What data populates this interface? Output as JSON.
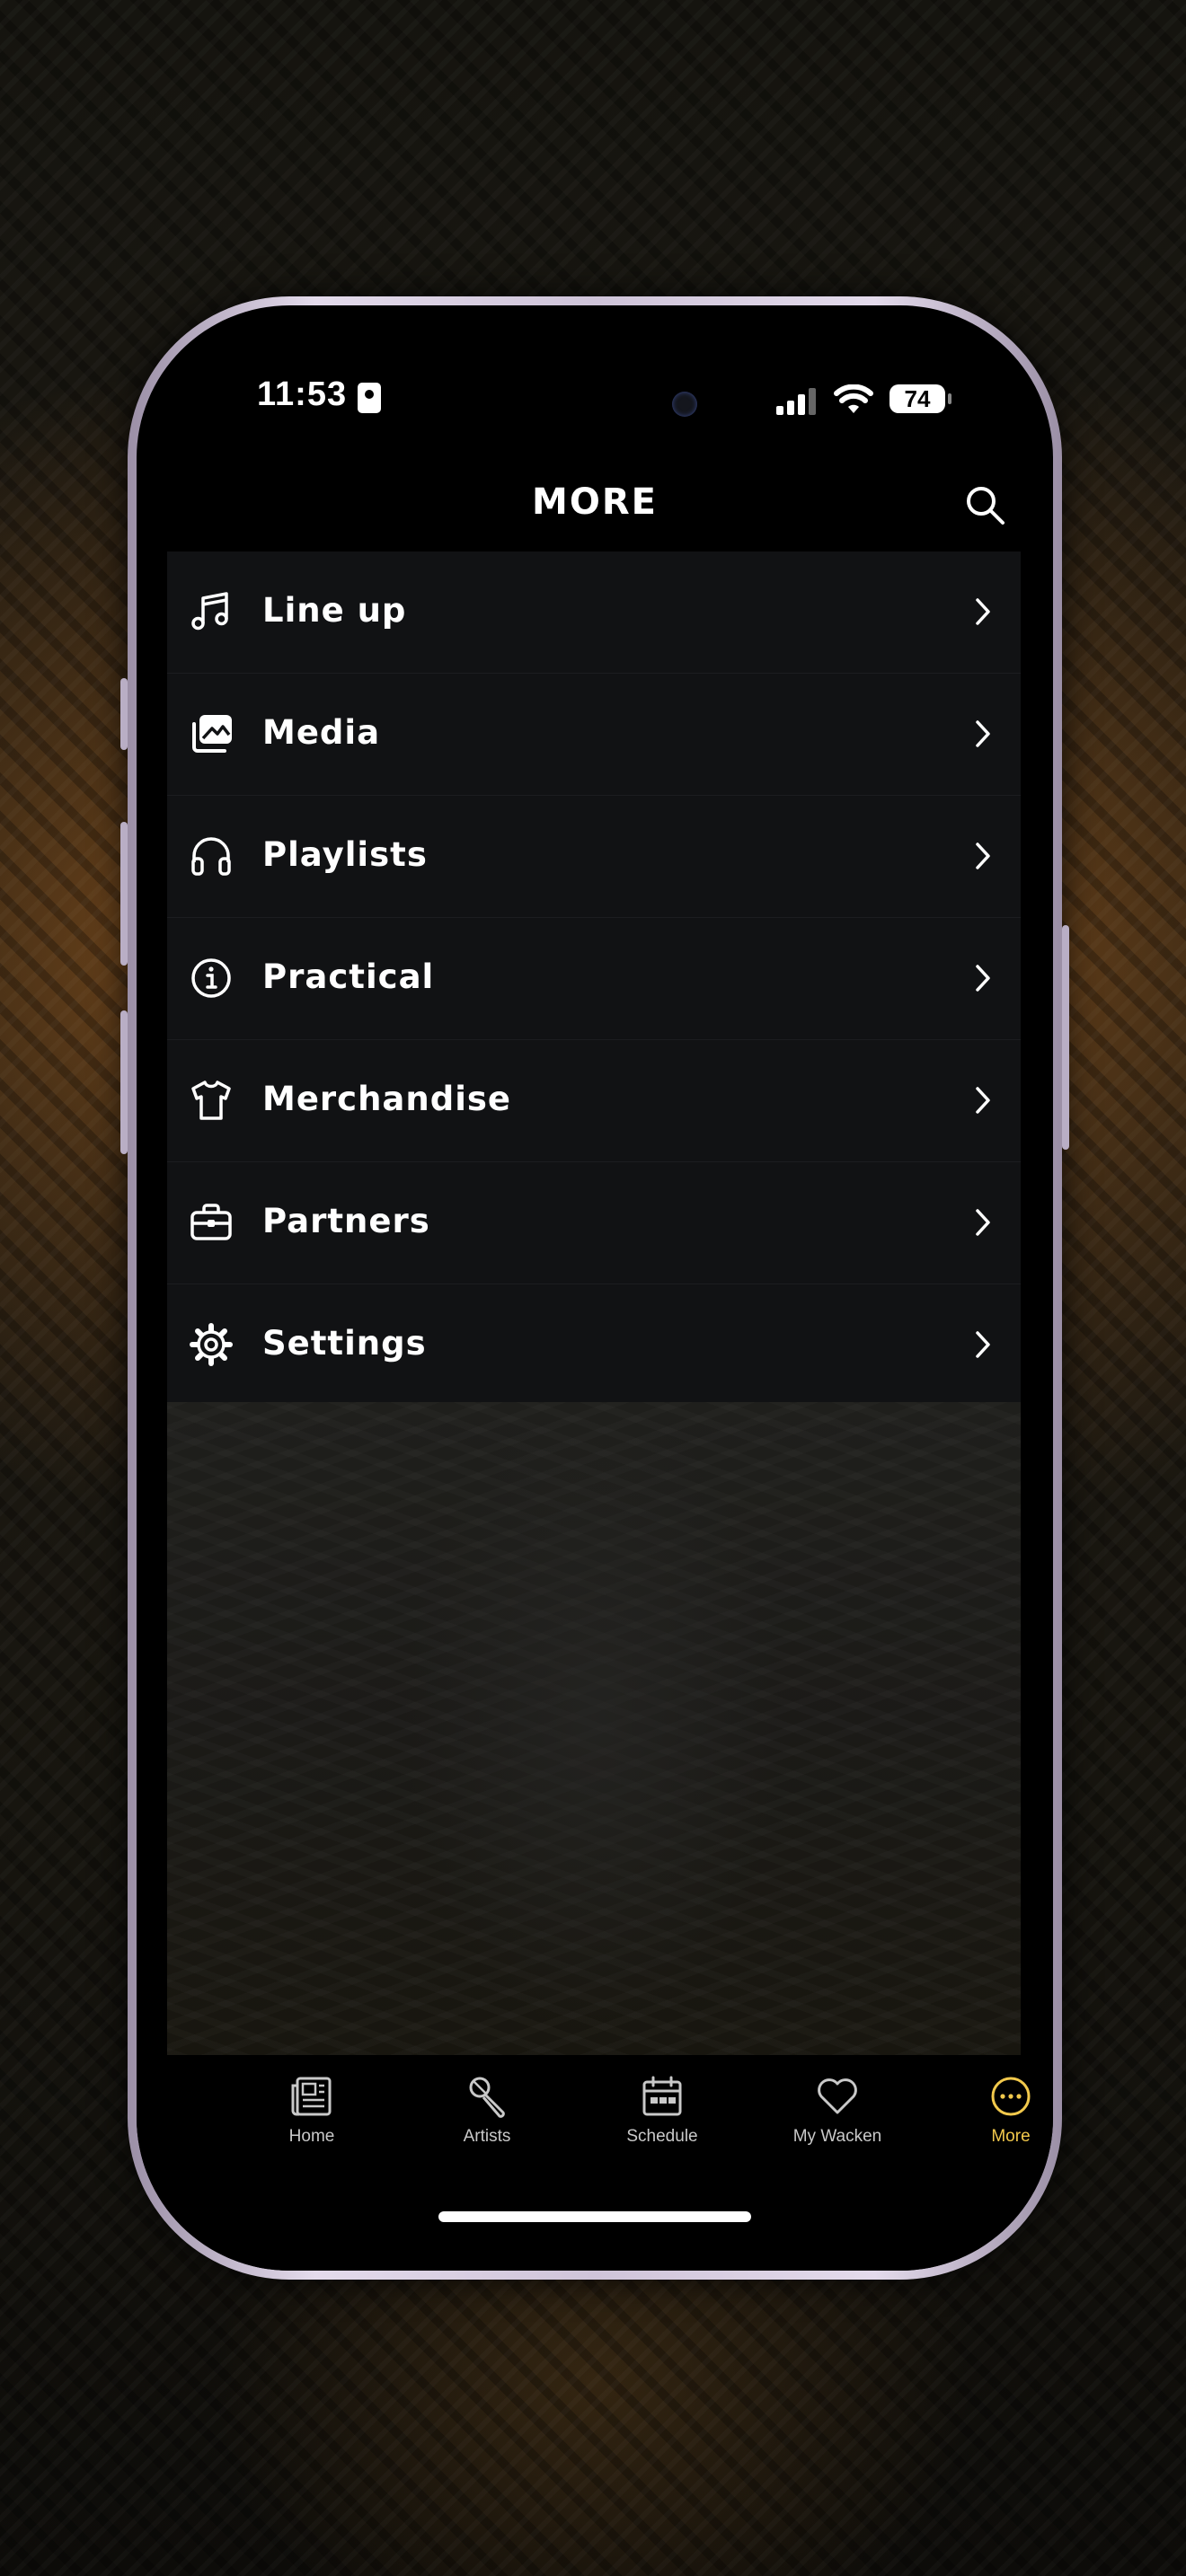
{
  "status_bar": {
    "time": "11:53",
    "battery": "74"
  },
  "header": {
    "title": "MORE"
  },
  "menu": [
    {
      "label": "Line up",
      "icon": "music-note-icon"
    },
    {
      "label": "Media",
      "icon": "images-icon"
    },
    {
      "label": "Playlists",
      "icon": "headphones-icon"
    },
    {
      "label": "Practical",
      "icon": "info-icon"
    },
    {
      "label": "Merchandise",
      "icon": "tshirt-icon"
    },
    {
      "label": "Partners",
      "icon": "briefcase-icon"
    },
    {
      "label": "Settings",
      "icon": "gear-icon"
    }
  ],
  "tabs": [
    {
      "label": "Home",
      "icon": "newspaper-icon"
    },
    {
      "label": "Artists",
      "icon": "microphone-icon"
    },
    {
      "label": "Schedule",
      "icon": "calendar-icon"
    },
    {
      "label": "My Wacken",
      "icon": "heart-icon"
    },
    {
      "label": "More",
      "icon": "more-icon",
      "active": true
    }
  ],
  "colors": {
    "accent": "#f2c94c",
    "row_bg": "#111214",
    "text": "#ffffff"
  }
}
